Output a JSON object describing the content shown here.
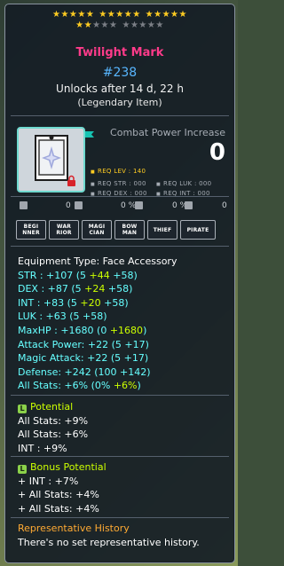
{
  "stars": {
    "row1_on": 15,
    "row2_on": 2,
    "row2_off": 8
  },
  "item": {
    "name": "Twilight Mark",
    "id": "#238",
    "unlock": "Unlocks after 14 d, 22 h",
    "rarity": "(Legendary Item)"
  },
  "combat": {
    "label": "Combat Power Increase",
    "value": "0"
  },
  "requirements": {
    "level": "REQ LEV : 140",
    "str": "REQ STR : 000",
    "luk": "REQ LUK : 000",
    "dex": "REQ DEX : 000",
    "int": "REQ INT : 000"
  },
  "icon_row": {
    "a_value": "0",
    "b_value": "0 %",
    "c_value": "0 %",
    "d_value": "0"
  },
  "jobs": [
    "BEGI\nNNER",
    "WAR\nRIOR",
    "MAGI\nCIAN",
    "BOW\nMAN",
    "THIEF",
    "PIRATE"
  ],
  "equipment": {
    "type": "Equipment Type: Face Accessory",
    "stats": [
      {
        "label": "STR : +107 (5 ",
        "parts": [
          {
            "t": "+44",
            "c": "yellow"
          },
          {
            "t": " +58)",
            "c": "cyan"
          }
        ]
      },
      {
        "label": "DEX : +87 (5 ",
        "parts": [
          {
            "t": "+24",
            "c": "yellow"
          },
          {
            "t": " +58)",
            "c": "cyan"
          }
        ]
      },
      {
        "label": "INT : +83 (5 ",
        "parts": [
          {
            "t": "+20",
            "c": "yellow"
          },
          {
            "t": " +58)",
            "c": "cyan"
          }
        ]
      },
      {
        "label": "LUK : +63 (5 +58)",
        "parts": []
      },
      {
        "label": "MaxHP : +1680 (0 ",
        "parts": [
          {
            "t": "+1680",
            "c": "yellow"
          },
          {
            "t": ")",
            "c": "cyan"
          }
        ]
      },
      {
        "label": "Attack Power: +22 (5 +17)",
        "parts": []
      },
      {
        "label": "Magic Attack: +22 (5 +17)",
        "parts": []
      },
      {
        "label": "Defense: +242 (100 +142)",
        "parts": []
      },
      {
        "label": "All Stats: +6% (0% ",
        "parts": [
          {
            "t": "+6%",
            "c": "yellow"
          },
          {
            "t": ")",
            "c": "cyan"
          }
        ]
      }
    ]
  },
  "potential": {
    "title": "Potential",
    "lines": [
      "All Stats: +9%",
      "All Stats: +6%",
      "INT : +9%"
    ]
  },
  "bonus_potential": {
    "title": "Bonus Potential",
    "lines": [
      "+ INT : +7%",
      "+ All Stats: +4%",
      "+ All Stats: +4%"
    ]
  },
  "history": {
    "title": "Representative History",
    "text": "There's no set representative history."
  },
  "colors": {
    "title": "#ff3b8a",
    "id": "#58b6ff",
    "stat_cyan": "#66ffff",
    "stat_yellow": "#ccff00",
    "star_gold": "#ffcc22",
    "history": "#ffaa33"
  }
}
